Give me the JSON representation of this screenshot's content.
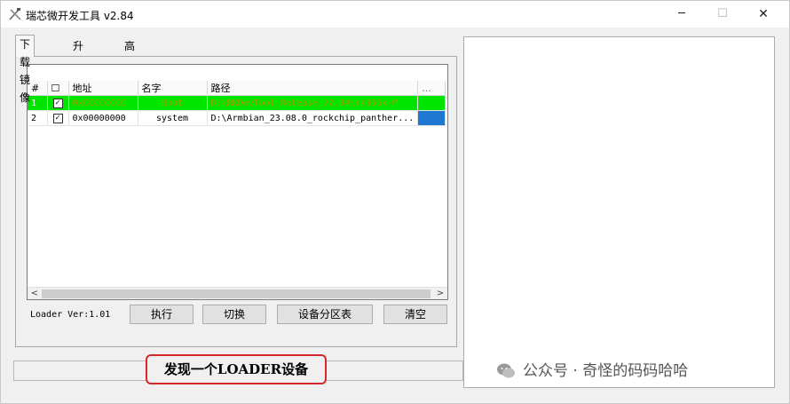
{
  "window": {
    "title": "瑞芯微开发工具 v2.84",
    "min_glyph": "─",
    "max_glyph": "☐",
    "close_glyph": "✕"
  },
  "tabs": [
    {
      "label": "下载镜像",
      "active": true
    },
    {
      "label": "升级固件",
      "active": false
    },
    {
      "label": "高级功能",
      "active": false
    }
  ],
  "table": {
    "headers": [
      "#",
      "☐",
      "地址",
      "名字",
      "路径",
      "..."
    ],
    "rows": [
      {
        "index": "1",
        "checked": "✓",
        "address": "0xCCCCCCCC",
        "name": "Boot",
        "path": "D:\\RKDevTool_Release_v2.84\\rk356x-M",
        "highlighted": true
      },
      {
        "index": "2",
        "checked": "✓",
        "address": "0x00000000",
        "name": "system",
        "path": "D:\\Armbian_23.08.0_rockchip_panther...",
        "highlighted": false
      }
    ]
  },
  "scrollbar": {
    "left_arrow": "<",
    "right_arrow": ">"
  },
  "loader_version": "Loader Ver:1.01",
  "buttons": {
    "execute": "执行",
    "switch": "切换",
    "partition": "设备分区表",
    "clear": "清空"
  },
  "status": "发现一个LOADER设备",
  "watermark": "公众号 · 奇怪的码码哈哈",
  "colors": {
    "selected_row": "#00e400",
    "status_border": "#d8262c",
    "cell_blue": "#1e78d2"
  }
}
